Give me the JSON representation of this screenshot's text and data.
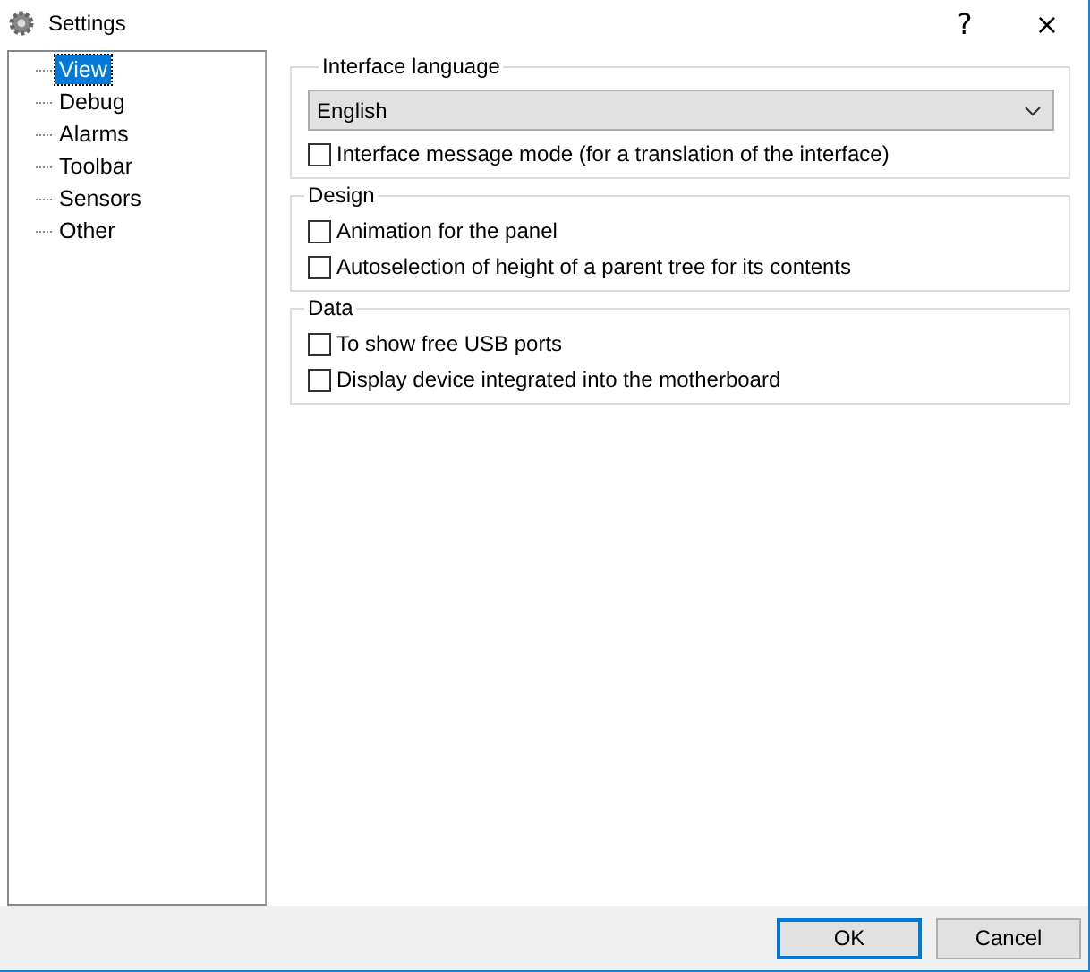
{
  "window": {
    "title": "Settings",
    "help": "?",
    "close": "×"
  },
  "sidebar": {
    "items": [
      {
        "label": "View",
        "selected": true
      },
      {
        "label": "Debug",
        "selected": false
      },
      {
        "label": "Alarms",
        "selected": false
      },
      {
        "label": "Toolbar",
        "selected": false
      },
      {
        "label": "Sensors",
        "selected": false
      },
      {
        "label": "Other",
        "selected": false
      }
    ]
  },
  "groups": [
    {
      "title": "Interface language",
      "dropdown": {
        "value": "English"
      },
      "options": [
        {
          "label": "Interface message mode (for a translation of the interface)",
          "checked": false
        }
      ]
    },
    {
      "title": "Design",
      "options": [
        {
          "label": "Animation for the panel",
          "checked": false
        },
        {
          "label": "Autoselection of height of a parent tree for its contents",
          "checked": false
        }
      ]
    },
    {
      "title": "Data",
      "options": [
        {
          "label": "To show free USB ports",
          "checked": false
        },
        {
          "label": "Display device integrated into the motherboard",
          "checked": false
        }
      ]
    }
  ],
  "buttons": [
    {
      "label": "OK",
      "default": true
    },
    {
      "label": "Cancel",
      "default": false
    }
  ]
}
